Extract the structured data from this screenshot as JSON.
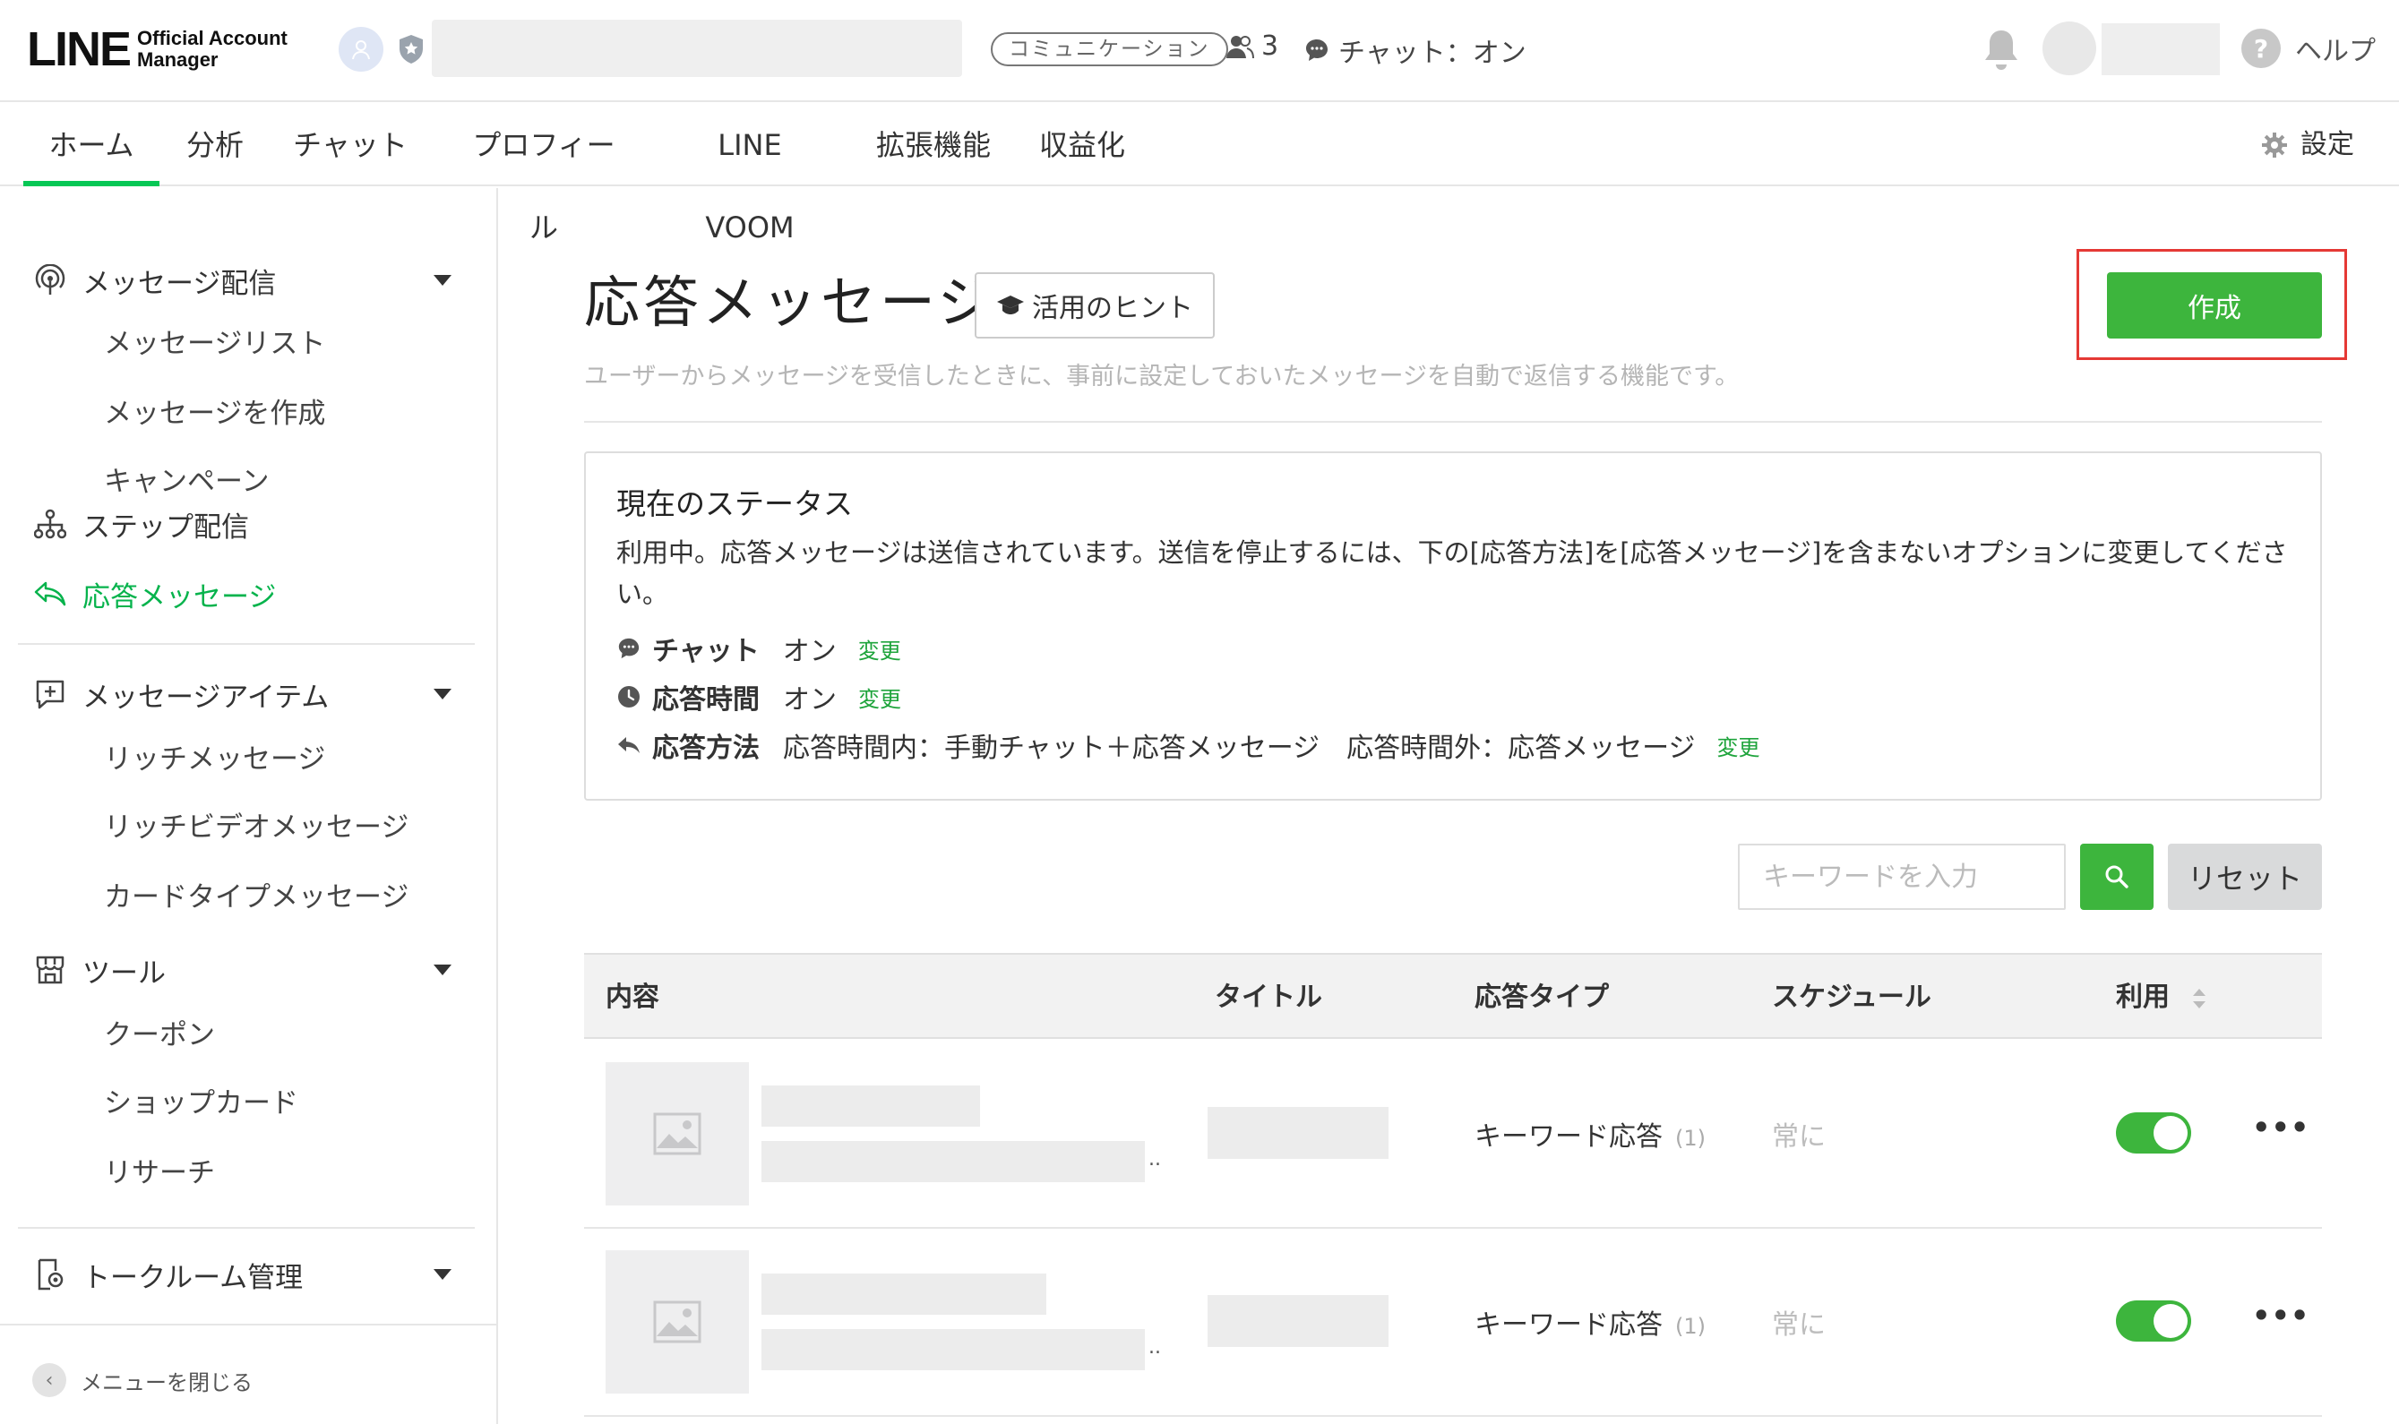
{
  "header": {
    "logo_main": "LINE",
    "logo_sub_1": "Official Account",
    "logo_sub_2": "Manager",
    "badge": "コミュニケーション",
    "friends_count": "3",
    "chat_status": "チャット：オン",
    "help_label": "ヘルプ",
    "help_glyph": "?"
  },
  "nav": {
    "tabs": [
      {
        "label": "ホーム",
        "active": true
      },
      {
        "label": "分析"
      },
      {
        "label": "チャット"
      },
      {
        "label": "プロフィール"
      },
      {
        "label": "LINE VOOM"
      },
      {
        "label": "拡張機能"
      },
      {
        "label": "収益化"
      }
    ],
    "settings_label": "設定"
  },
  "sidebar": {
    "sections": [
      {
        "label": "メッセージ配信",
        "items": [
          "メッセージリスト",
          "メッセージを作成",
          "キャンペーン"
        ]
      },
      {
        "label": "ステップ配信"
      },
      {
        "label": "応答メッセージ",
        "active": true
      },
      {
        "label": "メッセージアイテム",
        "items": [
          "リッチメッセージ",
          "リッチビデオメッセージ",
          "カードタイプメッセージ"
        ]
      },
      {
        "label": "ツール",
        "items": [
          "クーポン",
          "ショップカード",
          "リサーチ"
        ]
      },
      {
        "label": "トークルーム管理"
      }
    ],
    "close_label": "メニューを閉じる",
    "close_glyph": "‹"
  },
  "main": {
    "title": "応答メッセージ",
    "hint_label": "活用のヒント",
    "description": "ユーザーからメッセージを受信したときに、事前に設定しておいたメッセージを自動で返信する機能です。",
    "create_label": "作成",
    "status": {
      "title": "現在のステータス",
      "description": "利用中。応答メッセージは送信されています。送信を停止するには、下の[応答方法]を[応答メッセージ]を含まないオプションに変更してください。",
      "rows": [
        {
          "key": "チャット",
          "value": "オン",
          "change": "変更"
        },
        {
          "key": "応答時間",
          "value": "オン",
          "change": "変更"
        },
        {
          "key": "応答方法",
          "value": "応答時間内：手動チャット＋応答メッセージ",
          "value2": "応答時間外：応答メッセージ",
          "change": "変更"
        }
      ]
    },
    "search": {
      "placeholder": "キーワードを入力",
      "value": "",
      "reset_label": "リセット"
    },
    "table": {
      "columns": [
        "内容",
        "タイトル",
        "応答タイプ",
        "スケジュール",
        "利用"
      ],
      "rows": [
        {
          "type": "キーワード応答",
          "count": "(1)",
          "schedule": "常に",
          "enabled": true,
          "ellipsis": "..",
          "more": "•••"
        },
        {
          "type": "キーワード応答",
          "count": "(1)",
          "schedule": "常に",
          "enabled": true,
          "ellipsis": "..",
          "more": "•••"
        }
      ]
    }
  },
  "colors": {
    "accent_green": "#06c755",
    "button_green": "#3db53d",
    "highlight_red": "#e53935"
  }
}
